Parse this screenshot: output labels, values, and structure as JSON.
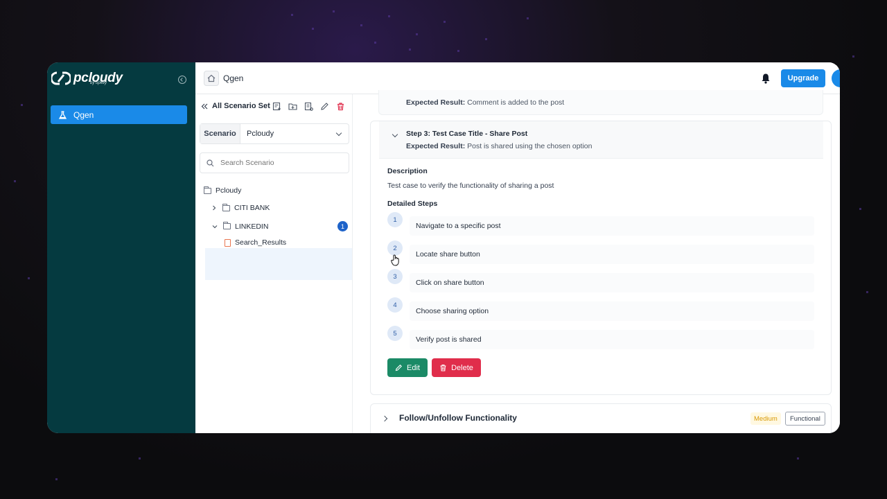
{
  "brand": {
    "name": "pcloudy",
    "sub": "by opkey"
  },
  "leftnav": {
    "items": [
      {
        "label": "Qgen",
        "icon": "flask-icon"
      }
    ]
  },
  "header": {
    "app_title": "Qgen",
    "upgrade_label": "Upgrade"
  },
  "scenario_panel": {
    "title": "All Scenario Set",
    "scenario_label": "Scenario",
    "scenario_value": "Pcloudy",
    "search_placeholder": "Search Scenario",
    "tree": {
      "root": "Pcloudy",
      "folders": [
        {
          "label": "CITI BANK",
          "expanded": false
        },
        {
          "label": "LINKEDIN",
          "expanded": true,
          "badge": "1",
          "children": [
            "Search_Results"
          ]
        }
      ]
    }
  },
  "main": {
    "previous": {
      "expected_label": "Expected Result:",
      "expected_value": "Comment is added to the post"
    },
    "current": {
      "step_title": "Step 3:  Test Case Title - Share Post",
      "expected_label": "Expected Result:",
      "expected_value": "Post is shared using the chosen option",
      "description_heading": "Description",
      "description": "Test case to verify the functionality of sharing a post",
      "steps_heading": "Detailed Steps",
      "steps": [
        {
          "num": "1",
          "text": "Navigate to a specific post"
        },
        {
          "num": "2",
          "text": "Locate share button"
        },
        {
          "num": "3",
          "text": "Click on share button"
        },
        {
          "num": "4",
          "text": "Choose sharing option"
        },
        {
          "num": "5",
          "text": "Verify post is shared"
        }
      ],
      "edit_label": "Edit",
      "delete_label": "Delete"
    },
    "next": {
      "title": "Follow/Unfollow Functionality",
      "priority": "Medium",
      "type": "Functional"
    }
  },
  "colors": {
    "nav_bg": "#053a40",
    "accent": "#1a8ae8",
    "edit": "#1b8a66",
    "delete": "#e02d4b",
    "medium": "#d99a06"
  }
}
